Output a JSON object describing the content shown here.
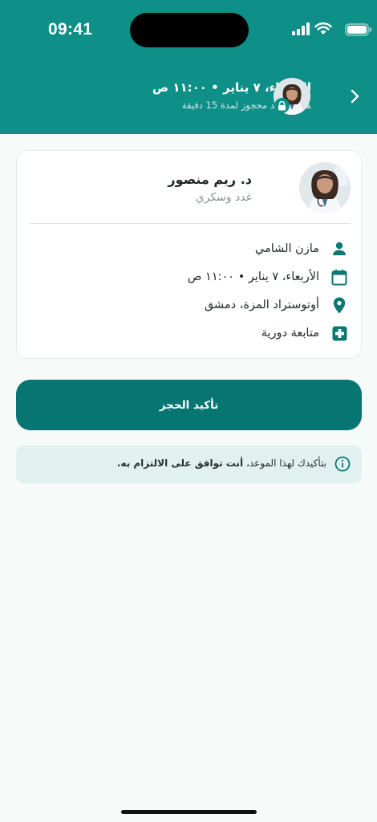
{
  "status_bar": {
    "time": "09:41"
  },
  "header": {
    "title": "الأربعاء، ٧ يناير • ١١:٠٠ ص",
    "subtitle": "هذا الموعد محجوز لمدة 15 دقيقة",
    "background_color": "#0e8f88"
  },
  "doctor": {
    "name": "د. ريم منصور",
    "specialty": "غدد وسكري"
  },
  "details": [
    {
      "icon": "person-icon",
      "text": "مازن الشامي"
    },
    {
      "icon": "calendar-icon",
      "text": "الأربعاء، ٧ يناير • ١١:٠٠ ص"
    },
    {
      "icon": "location-pin-icon",
      "text": "أوتوستراد المزة، دمشق"
    },
    {
      "icon": "medical-cross-icon",
      "text": "متابعة دورية"
    }
  ],
  "confirm_button": {
    "label": "تأكيد الحجز",
    "color": "#077572"
  },
  "notice": {
    "text_normal": "بتأكيدك لهذا الموعد، ",
    "text_bold": "أنت توافق على الالتزام به."
  }
}
